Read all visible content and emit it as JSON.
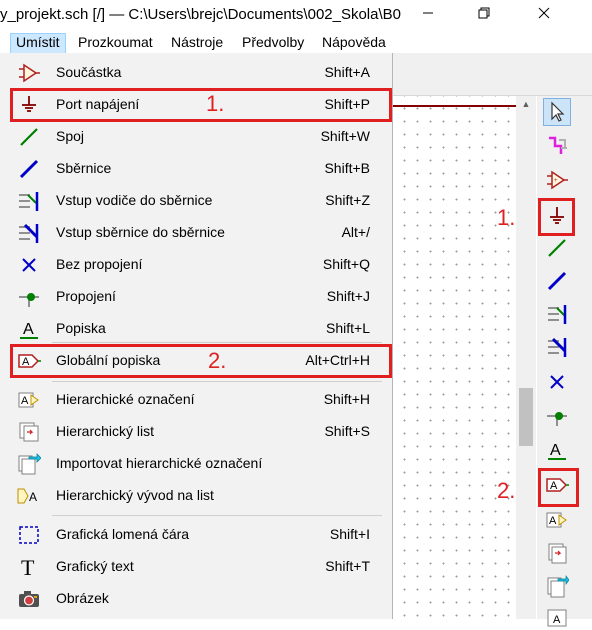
{
  "window": {
    "title": "y_projekt.sch [/] — C:\\Users\\brejc\\Documents\\002_Skola\\B0",
    "minimize_icon": "minimize-icon",
    "maximize_icon": "restore-icon",
    "close_icon": "close-icon"
  },
  "menubar": {
    "items": [
      {
        "label": "Umístit",
        "active": true
      },
      {
        "label": "Prozkoumat"
      },
      {
        "label": "Nástroje"
      },
      {
        "label": "Předvolby"
      },
      {
        "label": "Nápověda"
      }
    ]
  },
  "place_menu": {
    "items": [
      {
        "label": "Součástka",
        "shortcut": "Shift+A",
        "icon": "symbol-icon"
      },
      {
        "label": "Port napájení",
        "shortcut": "Shift+P",
        "icon": "power-port-icon"
      },
      {
        "label": "Spoj",
        "shortcut": "Shift+W",
        "icon": "wire-icon"
      },
      {
        "label": "Sběrnice",
        "shortcut": "Shift+B",
        "icon": "bus-icon"
      },
      {
        "label": "Vstup vodiče do sběrnice",
        "shortcut": "Shift+Z",
        "icon": "wire-to-bus-icon"
      },
      {
        "label": "Vstup sběrnice do sběrnice",
        "shortcut": "Alt+/",
        "icon": "bus-to-bus-icon"
      },
      {
        "label": "Bez propojení",
        "shortcut": "Shift+Q",
        "icon": "no-connect-icon"
      },
      {
        "label": "Propojení",
        "shortcut": "Shift+J",
        "icon": "junction-icon"
      },
      {
        "label": "Popiska",
        "shortcut": "Shift+L",
        "icon": "label-icon"
      },
      {
        "label": "Globální popiska",
        "shortcut": "Alt+Ctrl+H",
        "icon": "global-label-icon"
      },
      {
        "label": "Hierarchické označení",
        "shortcut": "Shift+H",
        "icon": "hier-label-icon"
      },
      {
        "label": "Hierarchický list",
        "shortcut": "Shift+S",
        "icon": "hier-sheet-icon"
      },
      {
        "label": "Importovat hierarchické označení",
        "shortcut": "",
        "icon": "import-hier-label-icon"
      },
      {
        "label": "Hierarchický vývod na list",
        "shortcut": "",
        "icon": "sheet-pin-icon"
      },
      {
        "label": "Grafická lomená čára",
        "shortcut": "Shift+I",
        "icon": "graphic-polyline-icon"
      },
      {
        "label": "Grafický text",
        "shortcut": "Shift+T",
        "icon": "graphic-text-icon"
      },
      {
        "label": "Obrázek",
        "shortcut": "",
        "icon": "image-icon"
      }
    ]
  },
  "annotations": {
    "marker_1": "1.",
    "marker_2": "2.",
    "rt_marker_1": "1.",
    "rt_marker_2": "2."
  },
  "right_toolbar": {
    "tools": [
      "select-icon",
      "hier-navigate-icon",
      "symbol-icon",
      "power-port-icon",
      "wire-icon",
      "bus-icon",
      "wire-to-bus-icon",
      "bus-to-bus-icon",
      "no-connect-icon",
      "junction-icon",
      "label-icon",
      "global-label-icon",
      "hier-label-icon",
      "hier-sheet-icon",
      "import-hier-label-icon",
      "sheet-pin-icon"
    ]
  },
  "colors": {
    "highlight": "#e02020",
    "wire": "#008000",
    "bus": "#0000c8",
    "power": "#840000"
  }
}
